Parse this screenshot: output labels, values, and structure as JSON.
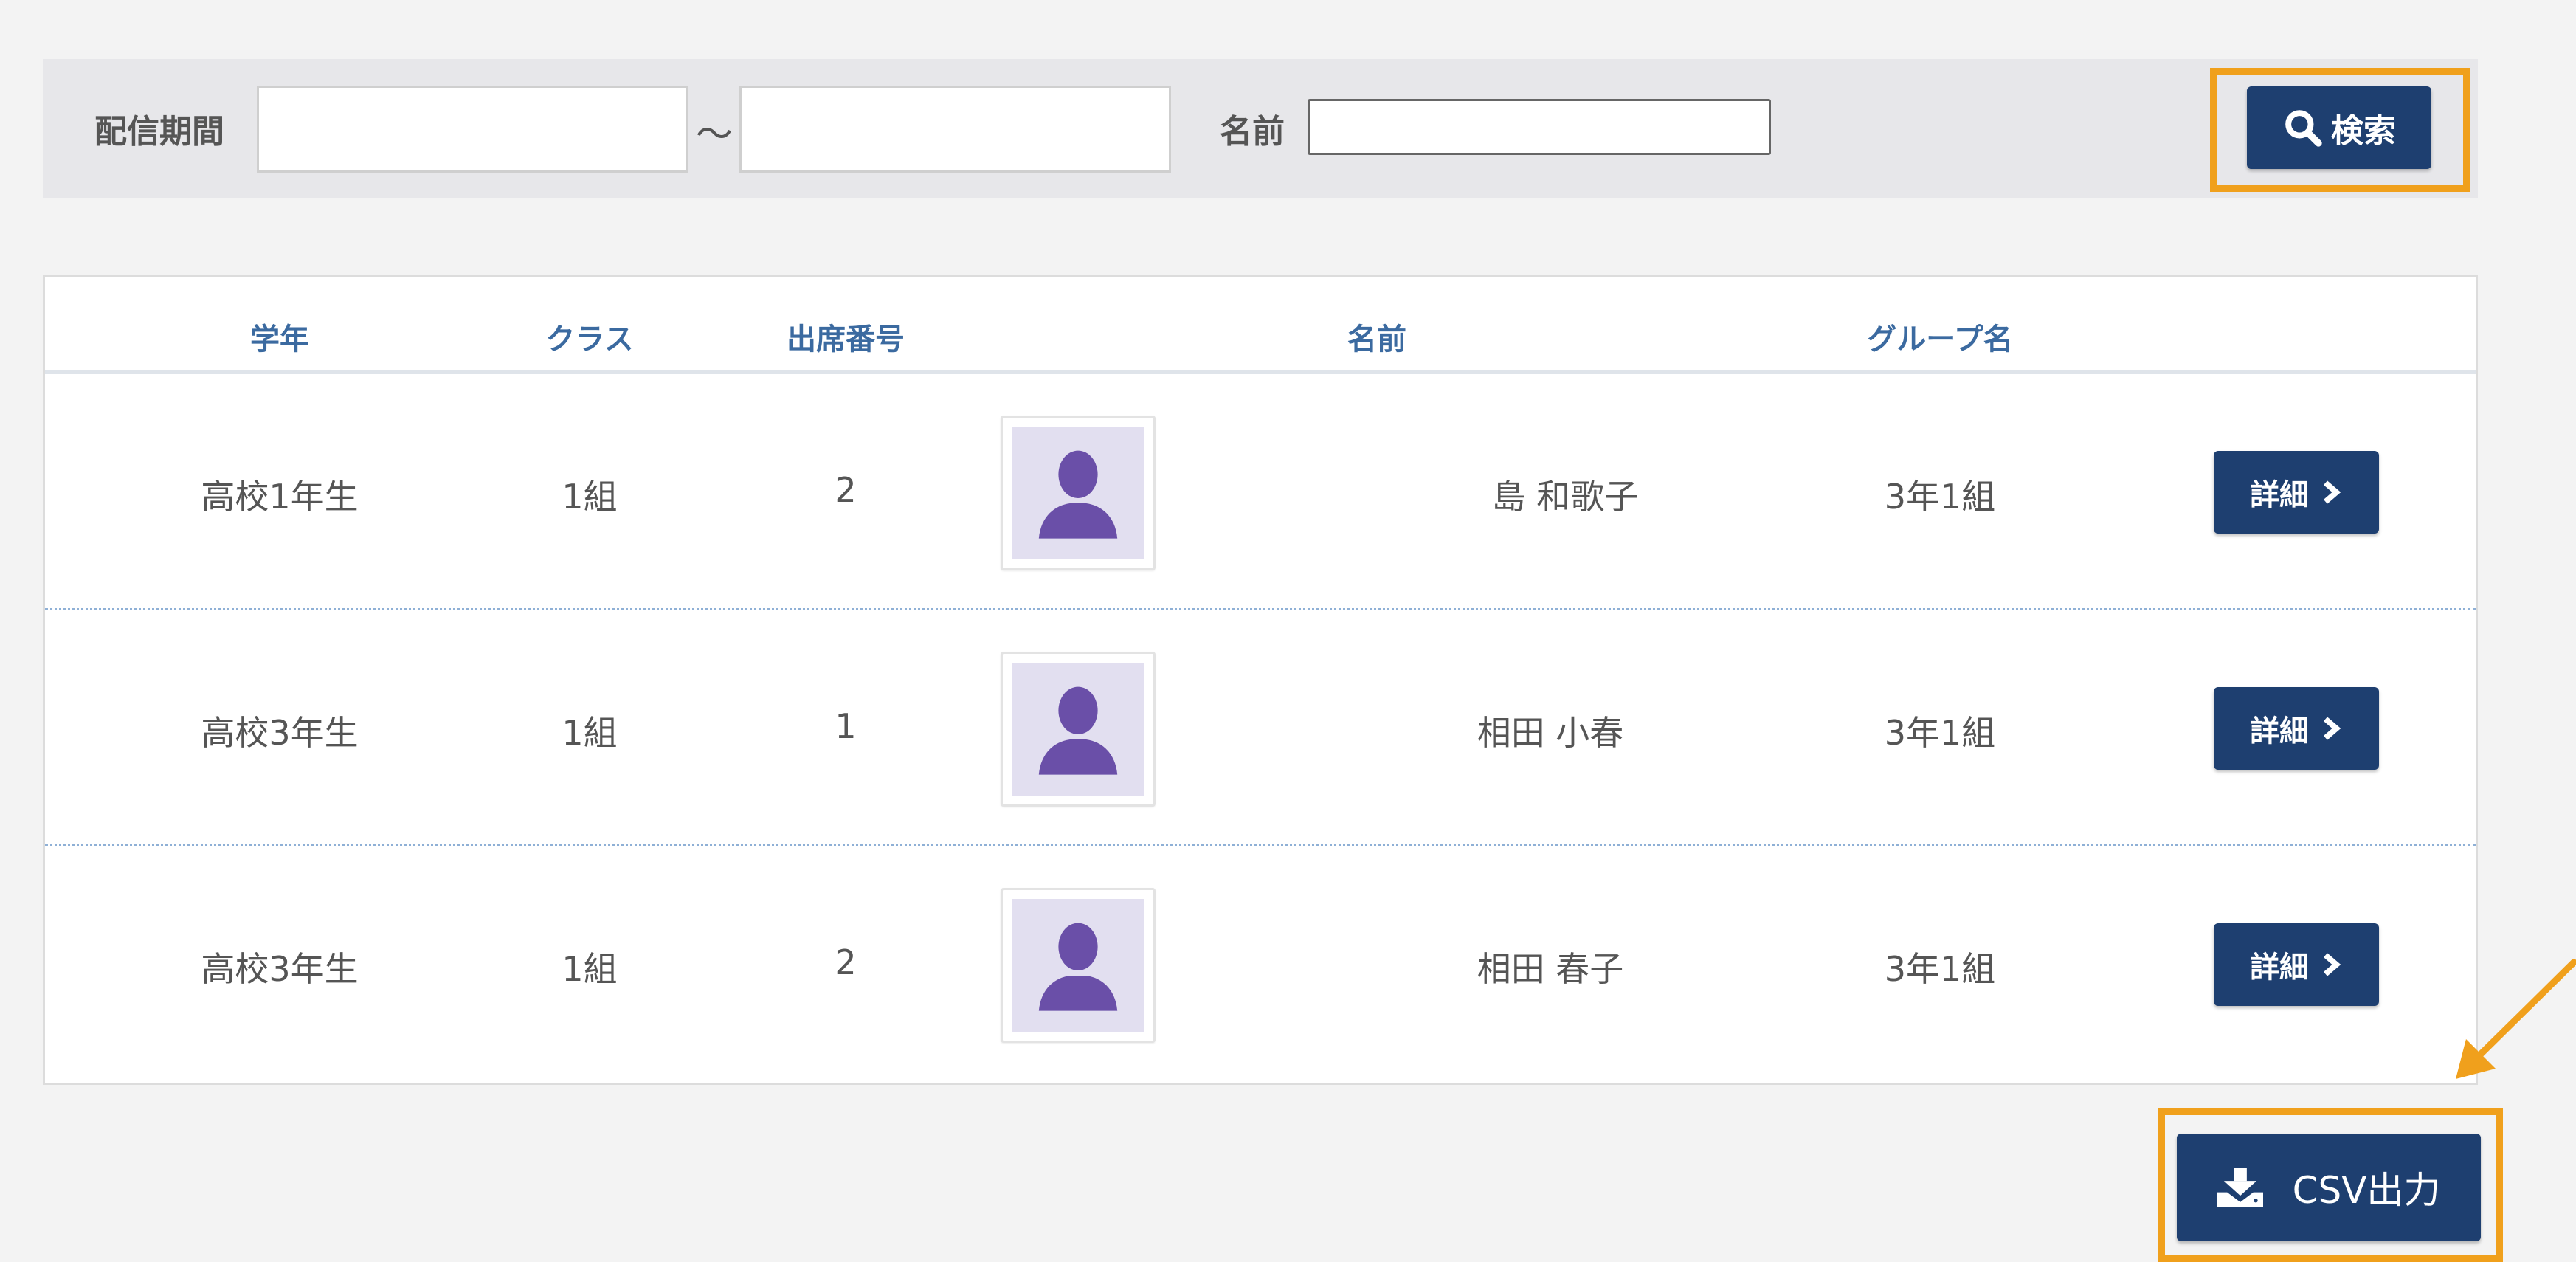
{
  "search": {
    "period_label": "配信期間",
    "tilde": "〜",
    "name_label": "名前",
    "date_from_value": "",
    "date_to_value": "",
    "name_value": "",
    "search_label": "検索"
  },
  "table": {
    "headers": {
      "grade": "学年",
      "class": "クラス",
      "number": "出席番号",
      "name": "名前",
      "group": "グループ名"
    },
    "rows": [
      {
        "grade": "高校1年生",
        "class": "1組",
        "number": "2",
        "name": "島 和歌子",
        "group": "3年1組",
        "detail": "詳細"
      },
      {
        "grade": "高校3年生",
        "class": "1組",
        "number": "1",
        "name": "相田 小春",
        "group": "3年1組",
        "detail": "詳細"
      },
      {
        "grade": "高校3年生",
        "class": "1組",
        "number": "2",
        "name": "相田 春子",
        "group": "3年1組",
        "detail": "詳細"
      }
    ]
  },
  "csv": {
    "label": "CSV出力"
  },
  "colors": {
    "accent_highlight": "#f0a01c",
    "button_primary": "#1e3f70",
    "header_text": "#3b6aa0",
    "avatar_silhouette": "#6a4fa8",
    "avatar_bg": "#e2dff0"
  },
  "icons": {
    "search": "search-icon",
    "detail": "chevron-right-icon",
    "csv": "download-icon",
    "avatar": "user-silhouette-icon",
    "annotation": "arrow-annotation-icon"
  }
}
